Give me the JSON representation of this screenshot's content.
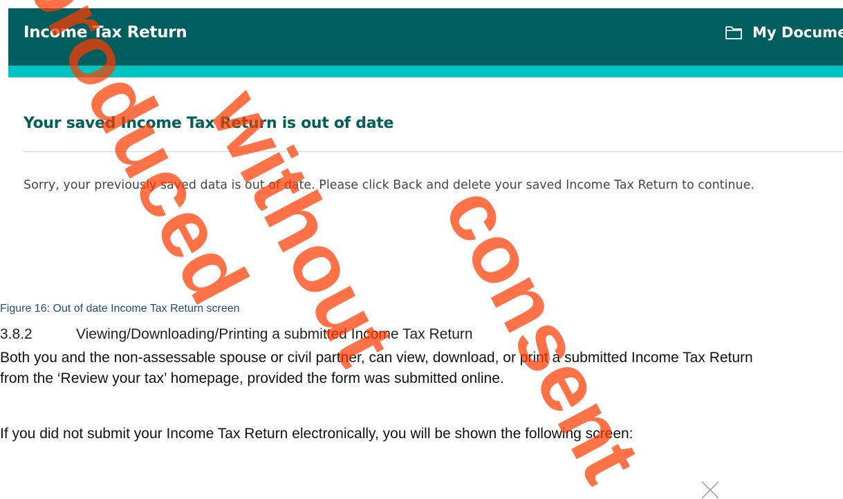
{
  "screenshot": {
    "header_title": "Income Tax Return",
    "documents_link": "My Docume",
    "heading": "Your saved Income Tax Return is out of date",
    "body": "Sorry, your previously saved data is out of date. Please click Back and delete your saved Income Tax Return to continue."
  },
  "caption": "Figure 16:  Out of date Income Tax Return screen",
  "section": {
    "number": "3.8.2",
    "title": "Viewing/Downloading/Printing a submitted Income Tax Return"
  },
  "paragraphs": [
    "Both you and the non-assessable spouse or civil partner, can view, download, or print a submitted Income Tax Return from the ‘Review your tax’ homepage, provided the form was submitted online.",
    "If you did not submit your Income Tax Return electronically, you will be shown the following screen:"
  ],
  "watermark": {
    "lines": [
      "Reproduced",
      "without",
      "consent"
    ]
  },
  "colors": {
    "header": "#005e5e",
    "accent": "#00c4c4",
    "heading": "#005e5e",
    "watermark": "#ff3b00",
    "caption": "#1f4e79"
  }
}
